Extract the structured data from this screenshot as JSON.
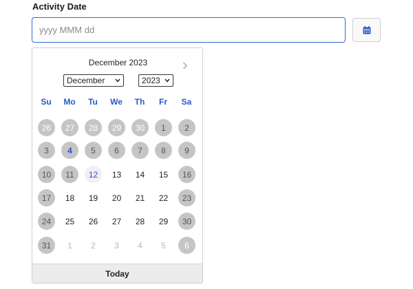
{
  "field": {
    "label": "Activity Date",
    "placeholder": "yyyy MMM dd",
    "value": ""
  },
  "calendar_button": {
    "icon": "calendar-icon"
  },
  "datepicker": {
    "title": "December 2023",
    "next_icon": "chevron-right-icon",
    "month_select": {
      "selected": "December"
    },
    "year_select": {
      "selected": "2023"
    },
    "weekdays": [
      "Su",
      "Mo",
      "Tu",
      "We",
      "Th",
      "Fr",
      "Sa"
    ],
    "weeks": [
      [
        "26",
        "27",
        "28",
        "29",
        "30",
        "1",
        "2"
      ],
      [
        "3",
        "4",
        "5",
        "6",
        "7",
        "8",
        "9"
      ],
      [
        "10",
        "11",
        "12",
        "13",
        "14",
        "15",
        "16"
      ],
      [
        "17",
        "18",
        "19",
        "20",
        "21",
        "22",
        "23"
      ],
      [
        "24",
        "25",
        "26",
        "27",
        "28",
        "29",
        "30"
      ],
      [
        "31",
        "1",
        "2",
        "3",
        "4",
        "5",
        "6"
      ]
    ],
    "selected_day": "4",
    "highlighted_today": "12",
    "today_label": "Today"
  },
  "colors": {
    "accent": "#2f67d8",
    "weekday_text": "#2758c9",
    "disabled_day_bg": "#c5c5c5"
  }
}
